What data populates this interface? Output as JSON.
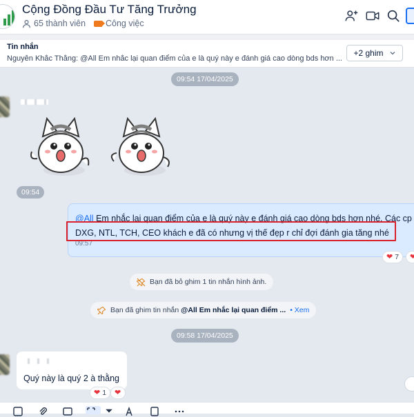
{
  "header": {
    "title": "Cộng Đồng Đầu Tư Tăng Trưởng",
    "members": "65 thành viên",
    "tag": "Công việc",
    "icons": [
      "add-member-icon",
      "video-call-icon",
      "search-icon",
      "panel-toggle-icon"
    ]
  },
  "pinbar": {
    "label": "Tin nhắn",
    "text": "Nguyễn Khắc Thắng: @All Em nhắc lại quan điểm của e là quý này e đánh giá cao dòng bds hơn ...",
    "more_label": "+2 ghim"
  },
  "timeline": {
    "first_time": "09:54 17/04/2025",
    "sticker_time": "09:54",
    "second_time": "09:58 17/04/2025"
  },
  "outgoing": {
    "mention": "@All",
    "line1": " Em nhắc lại quan điểm của e là quý này e đánh giá cao dòng bds hơn nhé. Các cp",
    "line2": "DXG, NTL, TCH, CEO khách e đã có nhưng vị thế đẹp r chỉ đợi đánh gia tăng nhé",
    "time": "09:57",
    "reaction_count": "7"
  },
  "notices": {
    "unpinned": "Bạn đã bỏ ghim 1 tin nhắn hình ảnh.",
    "pinned_prefix": "Bạn đã ghim tin nhắn ",
    "pinned_bold": "@All Em nhắc lại quan điểm ...",
    "pinned_link": "Xem"
  },
  "incoming": {
    "text": "Quý này là quý 2 à thằng",
    "reaction_count": "1"
  },
  "toolbar": {
    "icons": [
      "sticker-icon",
      "attach-icon",
      "card-icon",
      "screenshot-icon",
      "format-icon",
      "file-icon",
      "more-icon"
    ]
  },
  "colors": {
    "accent": "#1a6ff0",
    "highlight": "#d9202b",
    "outgoing_bubble": "#dbebff",
    "background": "#e4e8ef"
  }
}
